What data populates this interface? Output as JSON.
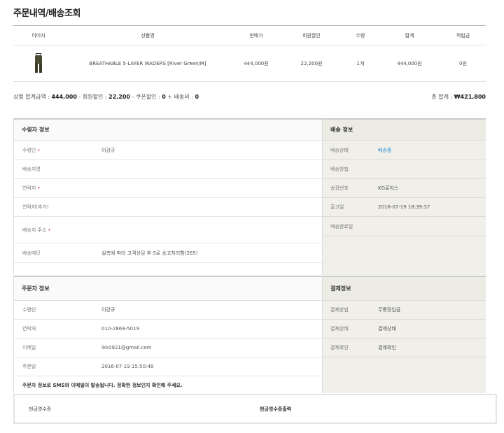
{
  "page_title": "주문내역/배송조회",
  "product_table": {
    "headers": {
      "image": "이미지",
      "name": "상품명",
      "price": "판매가",
      "member_discount": "회원할인",
      "qty": "수량",
      "total": "합계",
      "points": "적립금"
    },
    "row": {
      "name": "BREATHABLE 5-LAYER WADERS [River Green/M]",
      "price": "444,000원",
      "member_discount": "22,200원",
      "qty": "1개",
      "total": "444,000원",
      "points": "0원"
    }
  },
  "summary": {
    "left_prefix": "상품 합계금액 : ",
    "subtotal": "444,000",
    "member_label": " - 회원할인 : ",
    "member_discount": "22,200",
    "coupon_label": " - 쿠폰할인 : ",
    "coupon_discount": "0",
    "shipping_label": " + 배송비 : ",
    "shipping": "0",
    "grand_label": "총 합계 : ",
    "grand_total": "₩421,800"
  },
  "recipient": {
    "title": "수령자 정보",
    "name_label": "수령인",
    "name_value": "이강규",
    "place_label": "배송지명",
    "phone_label": "연락처",
    "phone2_label": "연락처(추가)",
    "address_label": "배송지 주소",
    "memo_label": "배송메모",
    "memo_value": "실측에 따라 고객상담 후 S로 송고처리함(265)"
  },
  "shipping": {
    "title": "배송 정보",
    "status_label": "배송상태",
    "status_value": "배송중",
    "method_label": "배송방법",
    "invoice_label": "송장번호",
    "invoice_value": "KG로지스",
    "released_label": "출고일",
    "released_value": "2016-07-19 18:39:37",
    "done_label": "배송완료일"
  },
  "orderer": {
    "title": "주문자 정보",
    "name_label": "수령인",
    "name_value": "이강규",
    "phone_label": "연락처",
    "phone_value": "010-2869-5019",
    "email_label": "이메일",
    "email_value": "lkk0921@gmail.com",
    "date_label": "주문일",
    "date_value": "2016-07-19 15:50:48",
    "notice": "주문자 정보로 SMS와 이메일이 발송됩니다. 정확한 정보인지 확인해 주세요."
  },
  "payment": {
    "title": "결제정보",
    "method_label": "결제방법",
    "method_value": "무통장입금",
    "status_label": "결제상태",
    "status_value": "결제상태",
    "confirm_label": "결제확인",
    "confirm_value": "결제확인"
  },
  "receipt": {
    "label": "현금영수증",
    "value": "현금영수증출력"
  },
  "colors": {
    "required": "#e03030",
    "link_blue": "#1a8ad6",
    "side_panel_bg": "#f0efe9"
  }
}
